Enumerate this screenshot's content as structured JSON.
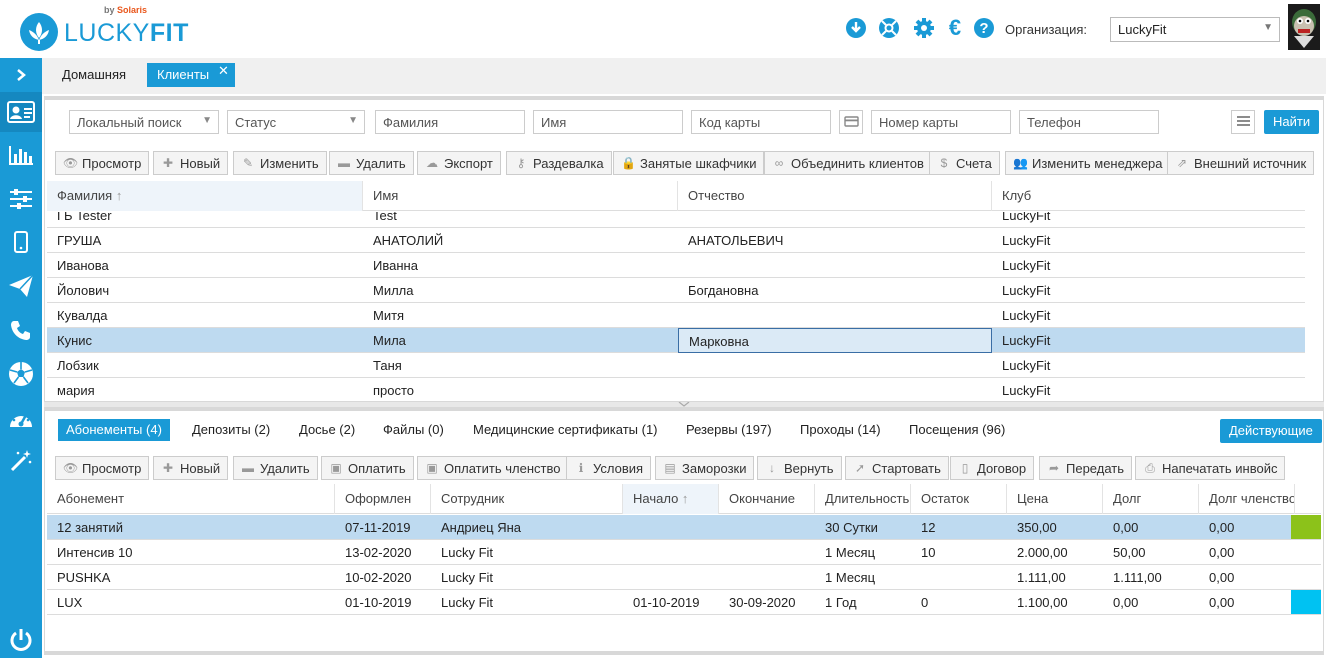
{
  "header": {
    "logo_text_light": "LUCKY",
    "logo_text_bold": "FIT",
    "logo_sub_by": "by",
    "logo_sub_brand": "Solaris",
    "org_label": "Организация:",
    "org_value": "LuckyFit",
    "icons": [
      "download-icon",
      "support-lifebuoy-icon",
      "settings-gear-icon",
      "euro-icon",
      "help-question-icon"
    ]
  },
  "sidebar": {
    "items": [
      "expand-arrow-icon",
      "clients-card-icon",
      "reports-chart-icon",
      "sliders-icon",
      "mobile-icon",
      "send-plane-icon",
      "phone-icon",
      "football-icon",
      "dashboard-gauge-icon",
      "magic-wand-icon",
      "power-icon"
    ]
  },
  "tabs": {
    "home": "Домашняя",
    "clients": "Клиенты",
    "close": "✕"
  },
  "filters": {
    "search_scope": "Локальный поиск",
    "status": "Статус",
    "lastname": "Фамилия",
    "firstname": "Имя",
    "card_code": "Код карты",
    "card_number": "Номер карты",
    "phone": "Телефон",
    "find": "Найти"
  },
  "toolbar1": [
    "Просмотр",
    "Новый",
    "Изменить",
    "Удалить",
    "Экспорт",
    "Раздевалка",
    "Занятые шкафчики",
    "Объединить клиентов",
    "Счета",
    "Изменить менеджера",
    "Внешний источник"
  ],
  "clients_table": {
    "columns": [
      "Фамилия",
      "Имя",
      "Отчество",
      "Клуб"
    ],
    "sort_arrow": "↑",
    "rows": [
      [
        "ГБ Tester",
        "Test",
        "",
        "LuckyFit"
      ],
      [
        "ГРУША",
        "АНАТОЛИЙ",
        "АНАТОЛЬЕВИЧ",
        "LuckyFit"
      ],
      [
        "Иванова",
        "Иванна",
        "",
        "LuckyFit"
      ],
      [
        "Йолович",
        "Милла",
        "Богдановна",
        "LuckyFit"
      ],
      [
        "Кувалда",
        "Митя",
        "",
        "LuckyFit"
      ],
      [
        "Кунис",
        "Мила",
        "Марковна",
        "LuckyFit"
      ],
      [
        "Лобзик",
        "Таня",
        "",
        "LuckyFit"
      ],
      [
        "мария",
        "просто",
        "",
        "LuckyFit"
      ]
    ]
  },
  "subtabs": [
    "Абонементы (4)",
    "Депозиты (2)",
    "Досье (2)",
    "Файлы (0)",
    "Медицинские сертификаты (1)",
    "Резервы (197)",
    "Проходы (14)",
    "Посещения (96)"
  ],
  "active_filter": "Действующие",
  "toolbar2": [
    "Просмотр",
    "Новый",
    "Удалить",
    "Оплатить",
    "Оплатить членство",
    "Условия",
    "Заморозки",
    "Вернуть",
    "Стартовать",
    "Договор",
    "Передать",
    "Напечатать инвойс"
  ],
  "subs_table": {
    "columns": [
      "Абонемент",
      "Оформлен",
      "Сотрудник",
      "Начало",
      "Окончание",
      "Длительность",
      "Остаток",
      "Цена",
      "Долг",
      "Долг членство"
    ],
    "sort_arrow": "↑",
    "rows": [
      [
        "12 занятий",
        "07-11-2019",
        "Андриец Яна",
        "",
        "",
        "30 Сутки",
        "12",
        "350,00",
        "0,00",
        "0,00"
      ],
      [
        "Интенсив 10",
        "13-02-2020",
        "Lucky Fit",
        "",
        "",
        "1 Месяц",
        "10",
        "2.000,00",
        "50,00",
        "0,00"
      ],
      [
        "PUSHKA",
        "10-02-2020",
        "Lucky Fit",
        "",
        "",
        "1 Месяц",
        "",
        "1.111,00",
        "1.111,00",
        "0,00"
      ],
      [
        "LUX",
        "01-10-2019",
        "Lucky Fit",
        "01-10-2019",
        "30-09-2020",
        "1 Год",
        "0",
        "1.100,00",
        "0,00",
        "0,00"
      ]
    ],
    "row_colors": [
      "#8cc21a",
      "",
      "",
      "#00c2f2"
    ]
  },
  "colors": {
    "accent": "#1a9ad6",
    "selected_row": "#bedaf0"
  }
}
